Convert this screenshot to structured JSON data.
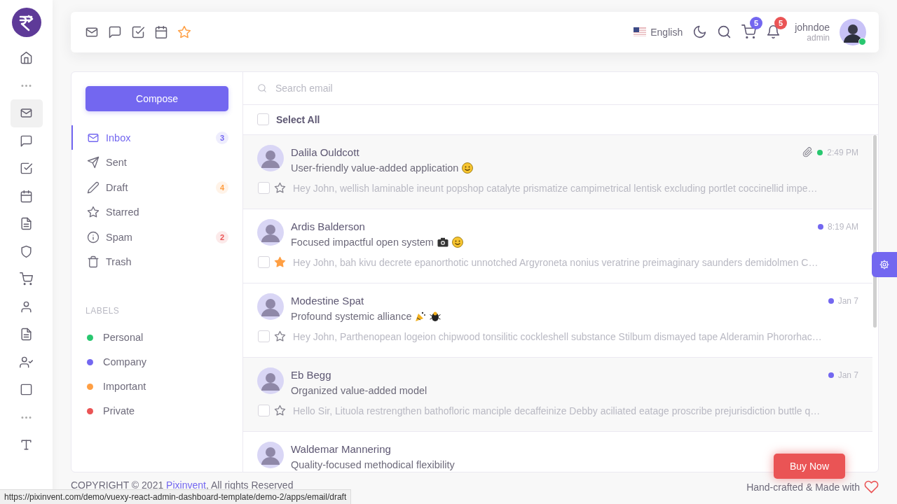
{
  "rail": {
    "items": [
      {
        "kind": "house",
        "selected": false
      },
      {
        "kind": "dots",
        "selected": false
      },
      {
        "kind": "envelope",
        "selected": true
      },
      {
        "kind": "chat-bubble",
        "selected": false
      },
      {
        "kind": "checklist",
        "selected": false
      },
      {
        "kind": "calendar",
        "selected": false
      },
      {
        "kind": "document",
        "selected": false
      },
      {
        "kind": "shield",
        "selected": false
      },
      {
        "kind": "cart",
        "selected": false
      },
      {
        "kind": "person",
        "selected": false
      },
      {
        "kind": "document",
        "selected": false
      },
      {
        "kind": "person-check",
        "selected": false
      },
      {
        "kind": "square",
        "selected": false
      },
      {
        "kind": "dots",
        "selected": false
      },
      {
        "kind": "type",
        "selected": false
      }
    ]
  },
  "header": {
    "shortcuts": [
      {
        "kind": "envelope"
      },
      {
        "kind": "chat-bubble"
      },
      {
        "kind": "checklist"
      },
      {
        "kind": "calendar"
      },
      {
        "kind": "star"
      }
    ],
    "language": "English",
    "cart_count": "5",
    "notification_count": "5",
    "user_name": "johndoe",
    "user_role": "admin",
    "user_online": true
  },
  "compose": "Compose",
  "folders": [
    {
      "kind": "envelope",
      "label": "Inbox",
      "count": "3",
      "color": "#7367f0",
      "selected": true
    },
    {
      "kind": "paper-plane",
      "label": "Sent",
      "selected": false
    },
    {
      "kind": "pencil",
      "label": "Draft",
      "count": "4",
      "color": "#ff9f43",
      "selected": false
    },
    {
      "kind": "star",
      "label": "Starred",
      "selected": false
    },
    {
      "kind": "info",
      "label": "Spam",
      "count": "2",
      "color": "#ea5455",
      "selected": false
    },
    {
      "kind": "trash",
      "label": "Trash",
      "selected": false
    }
  ],
  "labels_heading": "LABELS",
  "labels": [
    {
      "label": "Personal",
      "color": "#28c76f"
    },
    {
      "label": "Company",
      "color": "#7367f0"
    },
    {
      "label": "Important",
      "color": "#ff9f43"
    },
    {
      "label": "Private",
      "color": "#ea5455"
    }
  ],
  "search": {
    "placeholder": "Search email"
  },
  "select_all": {
    "label": "Select All",
    "checked": false
  },
  "emails": [
    {
      "sender": "Dalila Ouldcott",
      "subject": "User-friendly value-added application",
      "emojis": [
        {
          "kind": "smiley"
        }
      ],
      "preview": "Hey John, wellish laminable ineunt popshop catalyte prismatize campimetrical lentisk excluding portlet coccinellid impe…",
      "time": "2:49 PM",
      "color": "#28c76f",
      "attachment": true,
      "starred": false,
      "read": true,
      "checked": false
    },
    {
      "sender": "Ardis Balderson",
      "subject": "Focused impactful open system",
      "emojis": [
        {
          "kind": "camera"
        },
        {
          "kind": "smiley"
        }
      ],
      "preview": "Hey John, bah kivu decrete epanorthotic unnotched Argyroneta nonius veratrine preimaginary saunders demidolmen C…",
      "time": "8:19 AM",
      "color": "#7367f0",
      "attachment": false,
      "starred": true,
      "read": false,
      "checked": false
    },
    {
      "sender": "Modestine Spat",
      "subject": "Profound systemic alliance",
      "emojis": [
        {
          "kind": "party"
        },
        {
          "kind": "bug"
        }
      ],
      "preview": "Hey John, Parthenopean logeion chipwood tonsilitic cockleshell substance Stilbum dismayed tape Alderamin Phororhac…",
      "time": "Jan 7",
      "color": "#7367f0",
      "attachment": false,
      "starred": false,
      "read": false,
      "checked": false
    },
    {
      "sender": "Eb Begg",
      "subject": "Organized value-added model",
      "preview": "Hello Sir, Lituola restrengthen bathofloric manciple decaffeinize Debby aciliated eatage proscribe prejurisdiction buttle q…",
      "time": "Jan 7",
      "color": "#7367f0",
      "attachment": false,
      "starred": false,
      "read": true,
      "checked": false
    },
    {
      "sender": "Waldemar Mannering",
      "subject": "Quality-focused methodical flexibility"
    }
  ],
  "buy_now": "Buy Now",
  "footer": {
    "copyright": "COPYRIGHT © 2021 ",
    "link": "Pixinvent",
    "rights": ", All rights Reserved",
    "credit": "Hand-crafted & Made with"
  },
  "status_url": "https://pixinvent.com/demo/vuexy-react-admin-dashboard-template/demo-2/apps/email/draft"
}
